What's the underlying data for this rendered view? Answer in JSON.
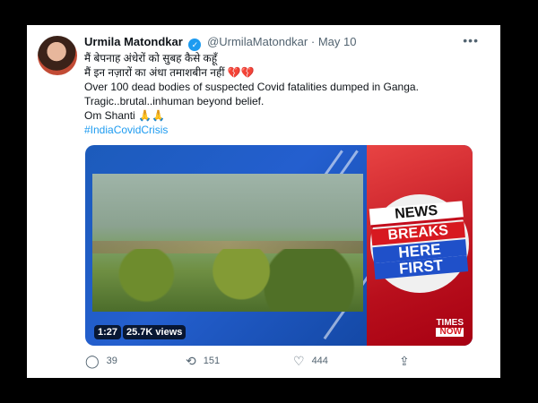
{
  "tweet": {
    "author_name": "Urmila Matondkar",
    "handle": "@UrmilaMatondkar",
    "date": "May 10",
    "more_icon": "more-icon",
    "lines": [
      "मैं बेपनाह अंधेरों को सुबह कैसे कहूँ",
      "मैं इन नज़ारों का अंधा तमाशबीन नहीं",
      "Over 100 dead bodies of suspected Covid fatalities dumped in Ganga.",
      "Tragic..brutal..inhuman beyond belief.",
      "Om Shanti"
    ],
    "hashtag": "#IndiaCovidCrisis"
  },
  "media": {
    "news_lines": [
      "NEWS",
      "BREAKS",
      "HERE",
      "FIRST"
    ],
    "channel_top": "TIMES",
    "channel_bottom": "NOW",
    "duration": "1:27",
    "views": "25.7K views"
  },
  "actions": {
    "reply_count": "39",
    "retweet_count": "151",
    "like_count": "444"
  },
  "colors": {
    "link": "#1d9bf0",
    "muted": "#536471",
    "news_red": "#d71920",
    "news_blue": "#1f50c9"
  }
}
